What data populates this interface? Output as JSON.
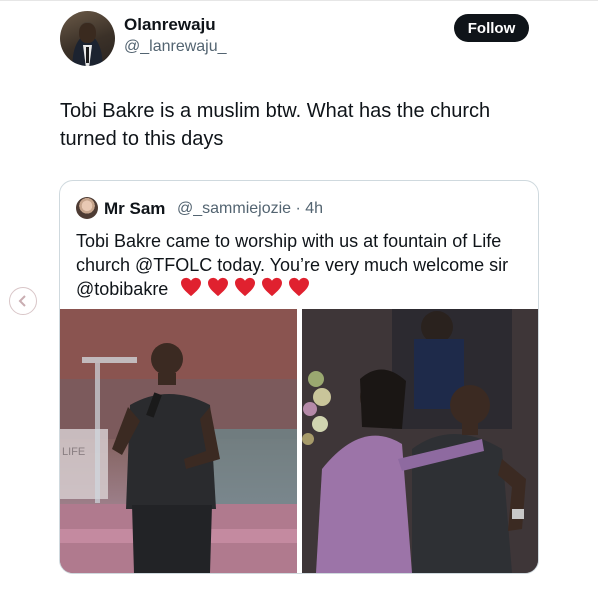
{
  "author": {
    "display_name": "Olanrewaju",
    "handle": "@_lanrewaju_"
  },
  "follow_label": "Follow",
  "tweet_text": "Tobi Bakre is a muslim btw. What has the church turned to this days",
  "quoted": {
    "display_name": "Mr Sam",
    "handle_time": "@_sammiejozie · 4h",
    "text": "Tobi Bakre came to worship with us at fountain of Life church @TFOLC today. You’re very much welcome sir @tobibakre",
    "heart_count": 5,
    "heart_color": "#e0212f",
    "images": [
      {
        "description_icon": "photo-preacher-on-stage",
        "sign_text": "LIFE"
      },
      {
        "description_icon": "photo-two-men-embracing"
      }
    ]
  },
  "nav": {
    "back_icon": "chevron-left-icon"
  },
  "colors": {
    "text": "#0f1419",
    "secondary": "#536471",
    "border": "#cfd9de",
    "button_bg": "#0f1419"
  }
}
